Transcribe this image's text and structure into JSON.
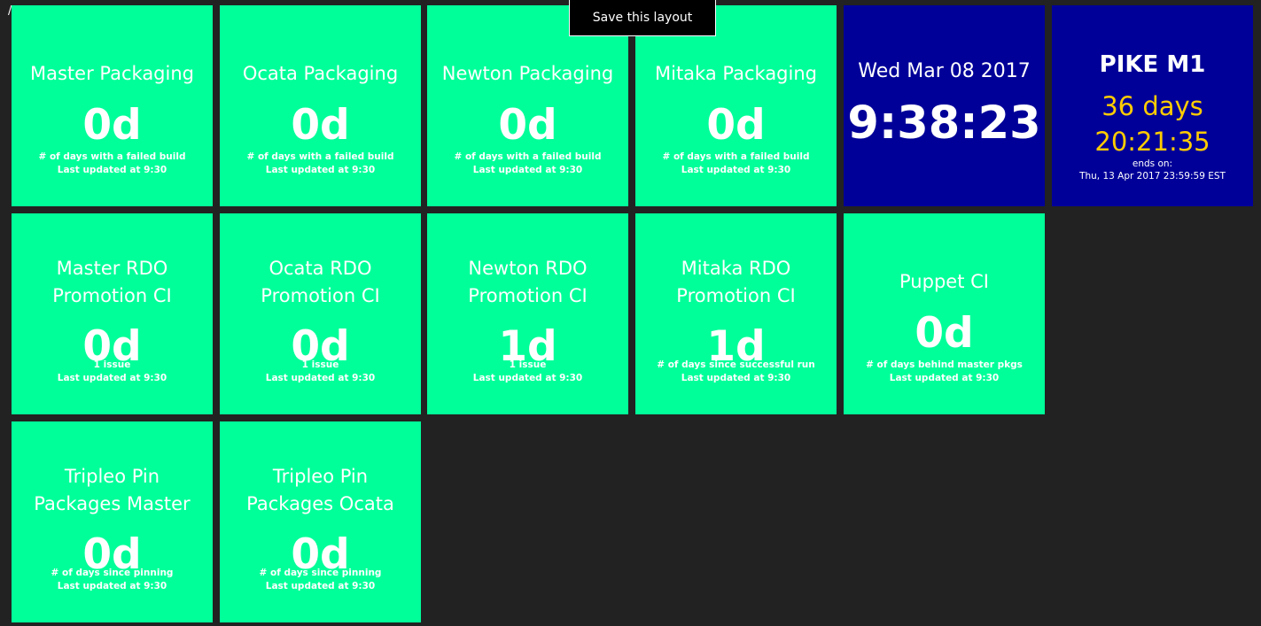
{
  "corner_text": "/",
  "save_button_label": "Save this layout",
  "colors": {
    "background": "#222222",
    "success": "#00ff99",
    "info": "#000099",
    "countdown_accent": "#ffcc00",
    "text": "#ffffff"
  },
  "widgets": {
    "master_packaging": {
      "title": "Master Packaging",
      "value": "0d",
      "more_info": "# of days with a failed build",
      "updated": "Last updated at 9:30"
    },
    "ocata_packaging": {
      "title": "Ocata Packaging",
      "value": "0d",
      "more_info": "# of days with a failed build",
      "updated": "Last updated at 9:30"
    },
    "newton_packaging": {
      "title": "Newton Packaging",
      "value": "0d",
      "more_info": "# of days with a failed build",
      "updated": "Last updated at 9:30"
    },
    "mitaka_packaging": {
      "title": "Mitaka Packaging",
      "value": "0d",
      "more_info": "# of days with a failed build",
      "updated": "Last updated at 9:30"
    },
    "clock": {
      "date": "Wed Mar 08 2017",
      "time": "9:38:23"
    },
    "countdown": {
      "title": "PIKE M1",
      "days": "36 days",
      "time": "20:21:35",
      "ends_label": "ends on:",
      "ends_date": "Thu, 13 Apr 2017 23:59:59 EST"
    },
    "master_rdo": {
      "title": "Master RDO Promotion CI",
      "value": "0d",
      "more_info": "1 issue",
      "updated": "Last updated at 9:30"
    },
    "ocata_rdo": {
      "title": "Ocata RDO Promotion CI",
      "value": "0d",
      "more_info": "1 issue",
      "updated": "Last updated at 9:30"
    },
    "newton_rdo": {
      "title": "Newton RDO Promotion CI",
      "value": "1d",
      "more_info": "1 issue",
      "updated": "Last updated at 9:30"
    },
    "mitaka_rdo": {
      "title": "Mitaka RDO Promotion CI",
      "value": "1d",
      "more_info": "# of days since successful run",
      "updated": "Last updated at 9:30"
    },
    "puppet_ci": {
      "title": "Puppet CI",
      "value": "0d",
      "more_info": "# of days behind master pkgs",
      "updated": "Last updated at 9:30"
    },
    "tripleo_pin_master": {
      "title": "Tripleo Pin Packages Master",
      "value": "0d",
      "more_info": "# of days since pinning",
      "updated": "Last updated at 9:30"
    },
    "tripleo_pin_ocata": {
      "title": "Tripleo Pin Packages Ocata",
      "value": "0d",
      "more_info": "# of days since pinning",
      "updated": "Last updated at 9:30"
    }
  }
}
